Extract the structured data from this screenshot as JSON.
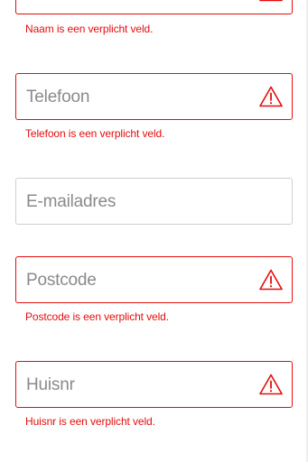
{
  "fields": [
    {
      "name": "naam",
      "placeholder": "",
      "error": "Naam is een verplicht veld.",
      "has_error": true
    },
    {
      "name": "telefoon",
      "placeholder": "Telefoon",
      "error": "Telefoon is een verplicht veld.",
      "has_error": true
    },
    {
      "name": "email",
      "placeholder": "E-mailadres",
      "error": "",
      "has_error": false
    },
    {
      "name": "postcode",
      "placeholder": "Postcode",
      "error": "Postcode is een verplicht veld.",
      "has_error": true
    },
    {
      "name": "huisnr",
      "placeholder": "Huisnr",
      "error": "Huisnr is een verplicht veld.",
      "has_error": true
    }
  ],
  "colors": {
    "error": "#e40d0d",
    "border": "#cfcfcf",
    "placeholder": "#8a8a8a"
  },
  "icons": {
    "warning": "warning-triangle-icon"
  }
}
